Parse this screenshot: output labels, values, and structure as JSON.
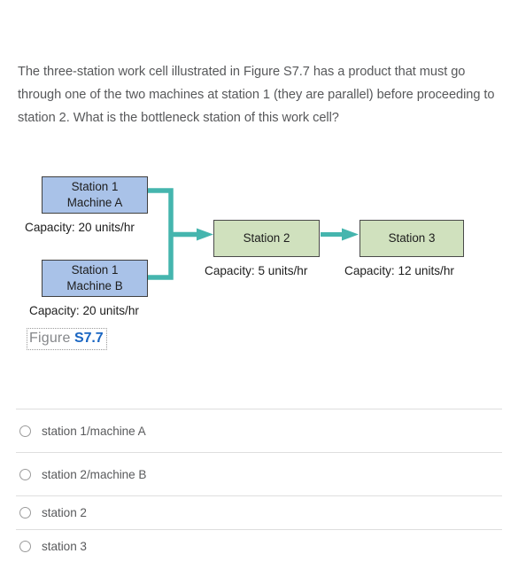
{
  "question": {
    "stem": "The three-station work cell illustrated in Figure S7.7 has a product that must go through one of the two machines at station 1 (they are parallel) before proceeding to station 2. What is the bottleneck station of this work cell?"
  },
  "figure": {
    "caption_word": "Figure",
    "caption_number": "S7.7",
    "colors": {
      "station1_fill": "#a9c2e8",
      "station23_fill": "#d0e1be",
      "connector": "#45b5ae",
      "box_border": "#3f3f3f"
    },
    "nodes": [
      {
        "id": "machine-a",
        "line1": "Station 1",
        "line2": "Machine A",
        "capacity": "Capacity: 20 units/hr"
      },
      {
        "id": "machine-b",
        "line1": "Station 1",
        "line2": "Machine B",
        "capacity": "Capacity: 20 units/hr"
      },
      {
        "id": "station-2",
        "line1": "Station 2",
        "line2": "",
        "capacity": "Capacity: 5 units/hr"
      },
      {
        "id": "station-3",
        "line1": "Station 3",
        "line2": "",
        "capacity": "Capacity: 12 units/hr"
      }
    ]
  },
  "options": [
    {
      "id": "opt-1",
      "label": "station 1/machine A",
      "selected": false
    },
    {
      "id": "opt-2",
      "label": "station 2/machine B",
      "selected": false
    },
    {
      "id": "opt-3",
      "label": "station 2",
      "selected": false
    },
    {
      "id": "opt-4",
      "label": "station 3",
      "selected": false
    }
  ]
}
